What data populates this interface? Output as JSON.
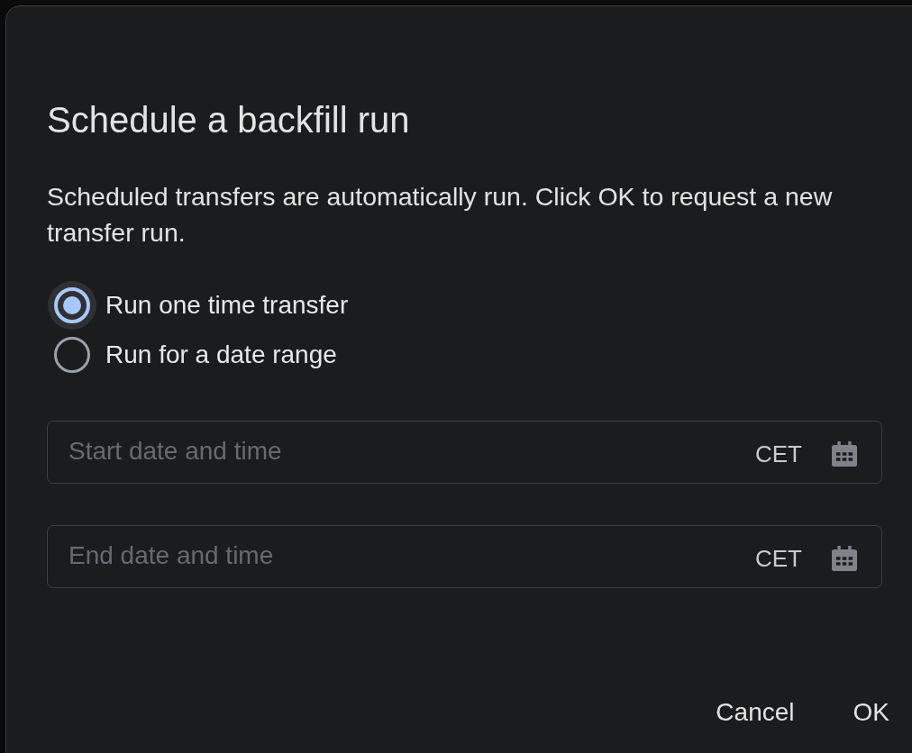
{
  "dialog": {
    "title": "Schedule a backfill run",
    "description": "Scheduled transfers are automatically run. Click OK to request a new transfer run.",
    "options": [
      {
        "label": "Run one time transfer",
        "selected": true
      },
      {
        "label": "Run for a date range",
        "selected": false
      }
    ],
    "fields": [
      {
        "placeholder": "Start date and time",
        "timezone": "CET"
      },
      {
        "placeholder": "End date and time",
        "timezone": "CET"
      }
    ],
    "buttons": [
      "Cancel",
      "OK"
    ]
  }
}
